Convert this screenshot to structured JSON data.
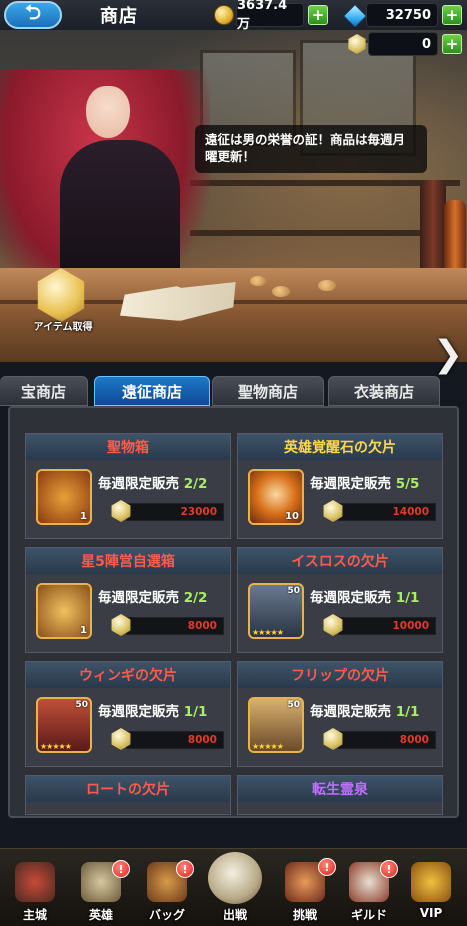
{
  "header": {
    "back_label": "⮌",
    "title": "商店",
    "gold": "3637.4万",
    "gems": "32750",
    "medals": "0",
    "plus": "+"
  },
  "scene": {
    "speech": "遠征は男の栄誉の証！商品は毎週月曜更新！",
    "item_acquire_label": "アイテム取得",
    "next_arrow": "❯"
  },
  "tabs": [
    {
      "label": "宝商店"
    },
    {
      "label": "遠征商店"
    },
    {
      "label": "聖物商店"
    },
    {
      "label": "衣装商店"
    }
  ],
  "limit_prefix": "毎週限定販売",
  "items": [
    {
      "name": "聖物箱",
      "name_color": "#ff5a4a",
      "count": "2/2",
      "price": "23000",
      "qty": "1"
    },
    {
      "name": "英雄覚醒石の欠片",
      "name_color": "#ffd84a",
      "count": "5/5",
      "price": "14000",
      "qty": "10"
    },
    {
      "name": "星5陣営自選箱",
      "name_color": "#ff5a4a",
      "count": "2/2",
      "price": "8000",
      "qty": "1"
    },
    {
      "name": "イスロスの欠片",
      "name_color": "#ff5a4a",
      "count": "1/1",
      "price": "10000",
      "level": "50",
      "stars": "★★★★★"
    },
    {
      "name": "ウィンギの欠片",
      "name_color": "#ff5a4a",
      "count": "1/1",
      "price": "8000",
      "level": "50",
      "stars": "★★★★★"
    },
    {
      "name": "フリップの欠片",
      "name_color": "#ff5a4a",
      "count": "1/1",
      "price": "8000",
      "level": "50",
      "stars": "★★★★★"
    },
    {
      "name": "ロートの欠片",
      "name_color": "#ff5a4a"
    },
    {
      "name": "転生霊泉",
      "name_color": "#c070ff"
    }
  ],
  "nav": [
    {
      "label": "主城"
    },
    {
      "label": "英雄"
    },
    {
      "label": "バッグ"
    },
    {
      "label": "出戦"
    },
    {
      "label": "挑戦"
    },
    {
      "label": "ギルド"
    },
    {
      "label": "VIP"
    }
  ],
  "badge_mark": "!"
}
